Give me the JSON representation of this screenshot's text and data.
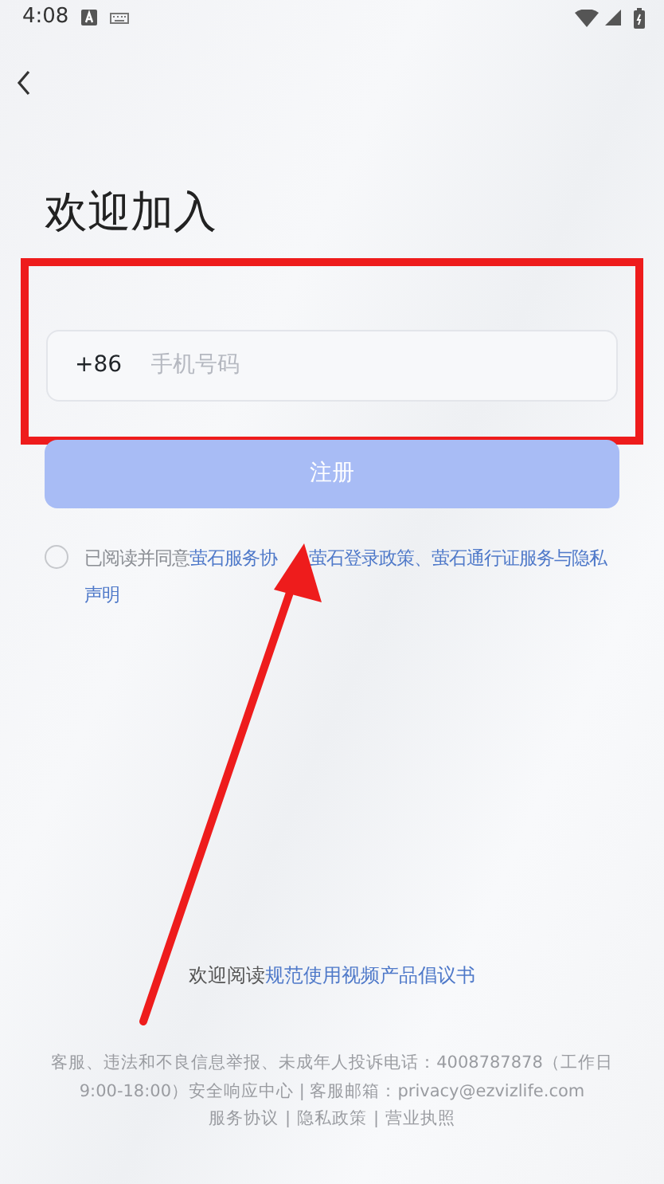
{
  "status_bar": {
    "time": "4:08"
  },
  "title": "欢迎加入",
  "phone_field": {
    "country_code": "+86",
    "placeholder": "手机号码"
  },
  "register_button": {
    "label": "注册",
    "disabled": true
  },
  "agreement": {
    "checked": false,
    "prefix": "已阅读并同意",
    "links": [
      "萤石服务协",
      "萤石登录政策、萤石通行证服务与隐私声明"
    ]
  },
  "initiative": {
    "prefix": "欢迎阅读",
    "link": "规范使用视频产品倡议书"
  },
  "footer": {
    "lines": [
      "客服、违法和不良信息举报、未成年人投诉电话：4008787878（工作日",
      "9:00-18:00）安全响应中心 | 客服邮箱：privacy@ezvizlife.com"
    ],
    "links": [
      {
        "label": "服务协议"
      },
      {
        "separator": "|"
      },
      {
        "label": "隐私政策"
      },
      {
        "separator": "|"
      },
      {
        "label": "营业执照"
      }
    ]
  },
  "annotations": {
    "highlight_box": true,
    "arrow": true
  }
}
